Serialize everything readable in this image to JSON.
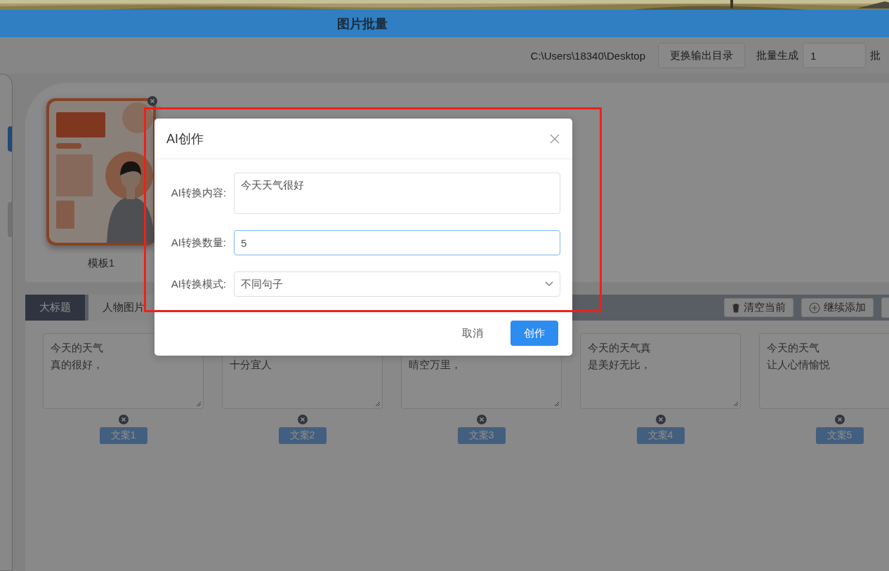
{
  "header": {
    "title": "图片批量"
  },
  "toolbar": {
    "output_path": "C:\\Users\\18340\\Desktop",
    "change_dir_button": "更换输出目录",
    "batch_label": "批量生成",
    "batch_count": "1",
    "batch_unit": "批"
  },
  "sidebar": {
    "items": [
      {
        "selected": true
      },
      {
        "selected": false
      }
    ]
  },
  "templates": [
    {
      "label": "模板1",
      "kind": "picture"
    }
  ],
  "tabs": [
    {
      "label": "大标题",
      "selected": true
    },
    {
      "label": "人物图片",
      "selected": false
    }
  ],
  "tab_actions": [
    {
      "label": "清空当前",
      "kind": "clear"
    },
    {
      "label": "继续添加",
      "kind": "add"
    }
  ],
  "texts": [
    {
      "lines": [
        "今天的天气",
        "真的很好，"
      ],
      "tag": "文案1",
      "kind": "full"
    },
    {
      "lines": [
        "十分宜人"
      ],
      "tag": "文案2",
      "kind": "covered"
    },
    {
      "lines": [
        "晴空万里，"
      ],
      "tag": "文案3",
      "kind": "covered"
    },
    {
      "lines": [
        "今天的天气真",
        "是美好无比，"
      ],
      "tag": "文案4",
      "kind": "full"
    },
    {
      "lines": [
        "今天的天气",
        "让人心情愉悦"
      ],
      "tag": "文案5",
      "kind": "full"
    }
  ],
  "dialog": {
    "title": "AI创作",
    "fields": [
      {
        "label": "AI转换内容:",
        "kind": "textarea",
        "value": "今天天气很好",
        "focused": false
      },
      {
        "label": "AI转换数量:",
        "kind": "input",
        "value": "5",
        "focused": true
      },
      {
        "label": "AI转换模式:",
        "kind": "select",
        "value": "不同句子",
        "focused": false
      }
    ],
    "buttons": [
      {
        "label": "取消",
        "primary": false
      },
      {
        "label": "创作",
        "primary": true
      }
    ]
  },
  "annotation": {
    "kind": "rectangle"
  }
}
